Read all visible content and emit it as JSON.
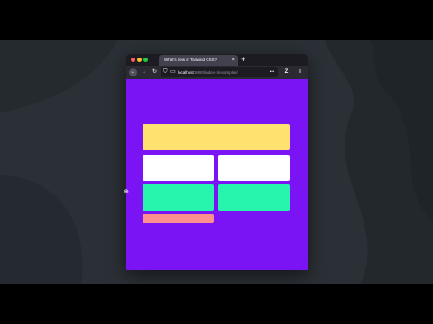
{
  "browser": {
    "tab_title": "What's new in Tailwind CSS?",
    "tab_close_icon": "×",
    "new_tab_icon": "+",
    "url_host": "localhost",
    "url_rest": ":8080/index-3/examples/",
    "url_more_icon": "•••",
    "back_icon": "←",
    "forward_icon": "→",
    "reload_icon": "↻",
    "shield_icon": "⛉",
    "page_icon": "▭",
    "extension_icon": "Z",
    "menu_icon": "≡"
  },
  "colors": {
    "page_background": "#7a14f5",
    "yellow": "#ffe170",
    "white": "#ffffff",
    "teal": "#27f5ad",
    "pink": "#ff8f8f"
  },
  "cursor_icon": "⊕"
}
